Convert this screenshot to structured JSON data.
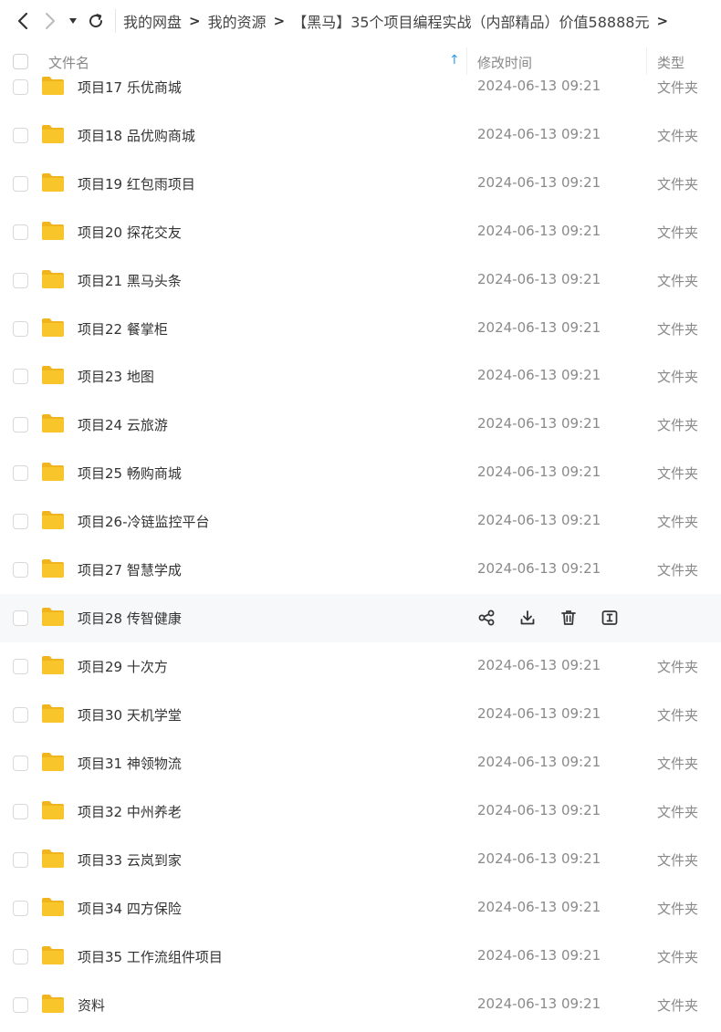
{
  "nav": {
    "back_icon": "chevron-left-icon",
    "forward_icon": "chevron-right-icon",
    "dropdown_icon": "caret-down-icon",
    "refresh_icon": "refresh-icon"
  },
  "breadcrumbs": [
    {
      "label": "我的网盘"
    },
    {
      "label": "我的资源"
    },
    {
      "label": "【黑马】35个项目编程实战（内部精品）价值58888元"
    }
  ],
  "header": {
    "name_label": "文件名",
    "sort_indicator": "↑",
    "time_label": "修改时间",
    "type_label": "类型"
  },
  "accent_color": "#2a9be8",
  "folder_color": "#f8c52b",
  "rows": [
    {
      "name": "项目17 乐优商城",
      "time": "2024-06-13 09:21",
      "type": "文件夹"
    },
    {
      "name": "项目18 品优购商城",
      "time": "2024-06-13 09:21",
      "type": "文件夹"
    },
    {
      "name": "项目19 红包雨项目",
      "time": "2024-06-13 09:21",
      "type": "文件夹"
    },
    {
      "name": "项目20 探花交友",
      "time": "2024-06-13 09:21",
      "type": "文件夹"
    },
    {
      "name": "项目21 黑马头条",
      "time": "2024-06-13 09:21",
      "type": "文件夹"
    },
    {
      "name": "项目22 餐掌柜",
      "time": "2024-06-13 09:21",
      "type": "文件夹"
    },
    {
      "name": "项目23 地图",
      "time": "2024-06-13 09:21",
      "type": "文件夹"
    },
    {
      "name": "项目24 云旅游",
      "time": "2024-06-13 09:21",
      "type": "文件夹"
    },
    {
      "name": "项目25 畅购商城",
      "time": "2024-06-13 09:21",
      "type": "文件夹"
    },
    {
      "name": "项目26-冷链监控平台",
      "time": "2024-06-13 09:21",
      "type": "文件夹"
    },
    {
      "name": "项目27 智慧学成",
      "time": "2024-06-13 09:21",
      "type": "文件夹"
    },
    {
      "name": "项目28 传智健康",
      "time": "",
      "type": "",
      "hover": true,
      "actions": [
        "share-icon",
        "download-icon",
        "delete-icon",
        "more-icon"
      ]
    },
    {
      "name": "项目29 十次方",
      "time": "2024-06-13 09:21",
      "type": "文件夹"
    },
    {
      "name": "项目30 天机学堂",
      "time": "2024-06-13 09:21",
      "type": "文件夹"
    },
    {
      "name": "项目31 神领物流",
      "time": "2024-06-13 09:21",
      "type": "文件夹"
    },
    {
      "name": "项目32 中州养老",
      "time": "2024-06-13 09:21",
      "type": "文件夹"
    },
    {
      "name": "项目33 云岚到家",
      "time": "2024-06-13 09:21",
      "type": "文件夹"
    },
    {
      "name": "项目34 四方保险",
      "time": "2024-06-13 09:21",
      "type": "文件夹"
    },
    {
      "name": "项目35 工作流组件项目",
      "time": "2024-06-13 09:21",
      "type": "文件夹"
    },
    {
      "name": "资料",
      "time": "2024-06-13 09:21",
      "type": "文件夹"
    }
  ]
}
